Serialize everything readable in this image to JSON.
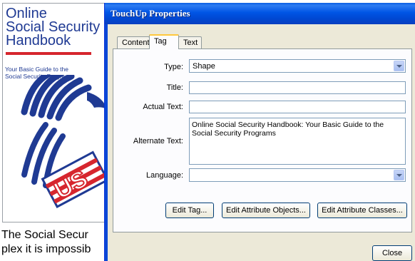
{
  "pdf_page": {
    "cover_title": [
      "Online",
      "Social Security",
      "Handbook"
    ],
    "cover_subtitle": [
      "Your Basic Guide to the",
      "Social Security Programs"
    ],
    "body_text": [
      "The Social Secur",
      "plex it is impossib"
    ],
    "logo_lettering": "US"
  },
  "dialog": {
    "title": "TouchUp Properties",
    "tabs": [
      "Content",
      "Tag",
      "Text"
    ],
    "active_tab": "Tag",
    "fields": {
      "type_label": "Type:",
      "type_value": "Shape",
      "title_label": "Title:",
      "title_value": "",
      "actual_text_label": "Actual Text:",
      "actual_text_value": "",
      "alternate_text_label": "Alternate Text:",
      "alternate_text_value": "Online Social Security Handbook: Your Basic Guide to the Social Security Programs",
      "language_label": "Language:",
      "language_value": ""
    },
    "buttons": {
      "edit_tag": "Edit Tag...",
      "edit_attribute_objects": "Edit Attribute Objects...",
      "edit_attribute_classes": "Edit Attribute Classes...",
      "close": "Close"
    }
  },
  "colors": {
    "titlebar": "#0055e5",
    "dialog_bg": "#ece9d8",
    "cover_blue": "#1f3a93",
    "cover_red": "#d6262e"
  }
}
